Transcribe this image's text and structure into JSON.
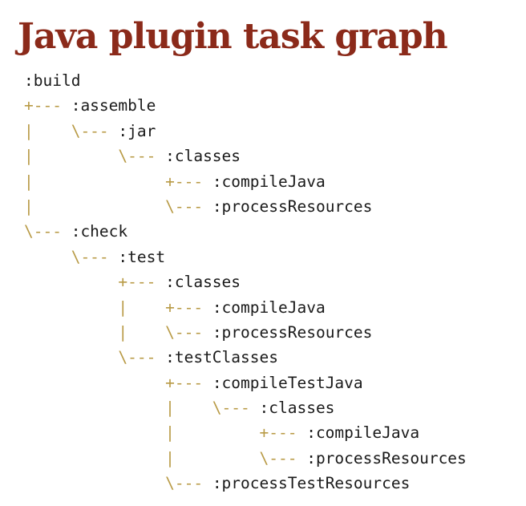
{
  "title": "Java plugin task graph",
  "tree": [
    {
      "prefix": "",
      "task": ":build"
    },
    {
      "prefix": "+--- ",
      "task": ":assemble"
    },
    {
      "prefix": "|    \\--- ",
      "task": ":jar"
    },
    {
      "prefix": "|         \\--- ",
      "task": ":classes"
    },
    {
      "prefix": "|              +--- ",
      "task": ":compileJava"
    },
    {
      "prefix": "|              \\--- ",
      "task": ":processResources"
    },
    {
      "prefix": "\\--- ",
      "task": ":check"
    },
    {
      "prefix": "     \\--- ",
      "task": ":test"
    },
    {
      "prefix": "          +--- ",
      "task": ":classes"
    },
    {
      "prefix": "          |    +--- ",
      "task": ":compileJava"
    },
    {
      "prefix": "          |    \\--- ",
      "task": ":processResources"
    },
    {
      "prefix": "          \\--- ",
      "task": ":testClasses"
    },
    {
      "prefix": "               +--- ",
      "task": ":compileTestJava"
    },
    {
      "prefix": "               |    \\--- ",
      "task": ":classes"
    },
    {
      "prefix": "               |         +--- ",
      "task": ":compileJava"
    },
    {
      "prefix": "               |         \\--- ",
      "task": ":processResources"
    },
    {
      "prefix": "               \\--- ",
      "task": ":processTestResources"
    }
  ],
  "colors": {
    "title": "#8b2a1a",
    "branch": "#b89a45",
    "task": "#1a1a1a"
  }
}
